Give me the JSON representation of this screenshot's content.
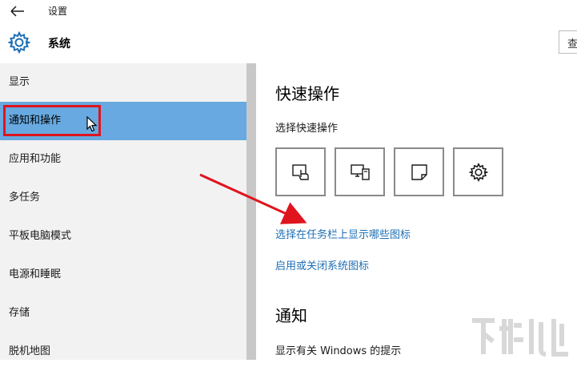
{
  "window": {
    "title": "设置"
  },
  "header": {
    "title": "系统",
    "search_placeholder": "查"
  },
  "sidebar": {
    "items": [
      {
        "label": "显示"
      },
      {
        "label": "通知和操作"
      },
      {
        "label": "应用和功能"
      },
      {
        "label": "多任务"
      },
      {
        "label": "平板电脑模式"
      },
      {
        "label": "电源和睡眠"
      },
      {
        "label": "存储"
      },
      {
        "label": "脱机地图"
      }
    ],
    "selected_index": 1
  },
  "content": {
    "quick_actions_heading": "快速操作",
    "quick_actions_sub": "选择快速操作",
    "tiles": [
      {
        "icon": "tablet-mode-icon"
      },
      {
        "icon": "project-icon"
      },
      {
        "icon": "note-icon"
      },
      {
        "icon": "settings-gear-icon"
      }
    ],
    "link_taskbar_icons": "选择在任务栏上显示哪些图标",
    "link_system_icons": "启用或关闭系统图标",
    "notifications_heading": "通知",
    "notifications_sub": "显示有关 Windows 的提示"
  },
  "colors": {
    "accent": "#67a9e0",
    "link": "#1e6fb4",
    "highlight_box": "#e0141e",
    "arrow": "#e0141e"
  }
}
